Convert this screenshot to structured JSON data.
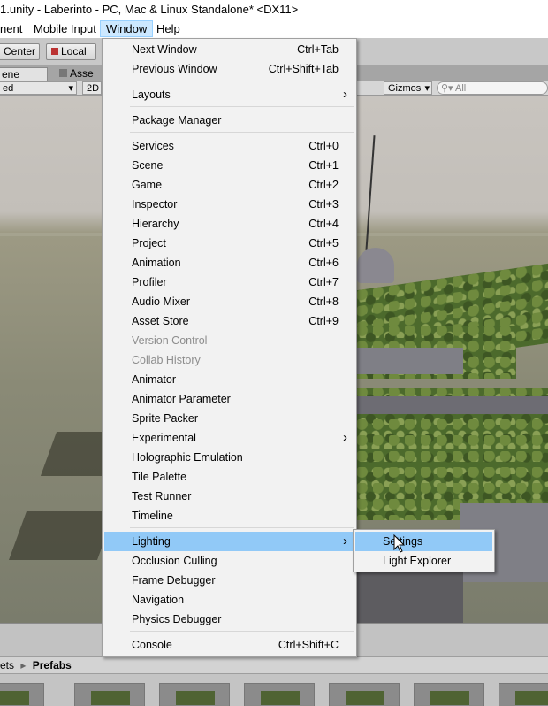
{
  "window": {
    "title": "1.unity - Laberinto - PC, Mac & Linux Standalone* <DX11>"
  },
  "menubar": {
    "items": [
      "nent",
      "Mobile Input",
      "Window",
      "Help"
    ],
    "active": "Window"
  },
  "toolbar": {
    "center_label": "Center",
    "local_label": "Local"
  },
  "tabs": {
    "scene": "ene",
    "assets": "Asse"
  },
  "scenebar": {
    "shaded": "ed",
    "mode_2d": "2D",
    "gizmos": "Gizmos",
    "search_placeholder": "All"
  },
  "window_menu": {
    "items": [
      {
        "label": "Next Window",
        "shortcut": "Ctrl+Tab"
      },
      {
        "label": "Previous Window",
        "shortcut": "Ctrl+Shift+Tab"
      },
      {
        "label": "Layouts",
        "submenu": true
      },
      {
        "label": "Package Manager"
      },
      {
        "label": "Services",
        "shortcut": "Ctrl+0"
      },
      {
        "label": "Scene",
        "shortcut": "Ctrl+1"
      },
      {
        "label": "Game",
        "shortcut": "Ctrl+2"
      },
      {
        "label": "Inspector",
        "shortcut": "Ctrl+3"
      },
      {
        "label": "Hierarchy",
        "shortcut": "Ctrl+4"
      },
      {
        "label": "Project",
        "shortcut": "Ctrl+5"
      },
      {
        "label": "Animation",
        "shortcut": "Ctrl+6"
      },
      {
        "label": "Profiler",
        "shortcut": "Ctrl+7"
      },
      {
        "label": "Audio Mixer",
        "shortcut": "Ctrl+8"
      },
      {
        "label": "Asset Store",
        "shortcut": "Ctrl+9"
      },
      {
        "label": "Version Control",
        "disabled": true
      },
      {
        "label": "Collab History",
        "disabled": true
      },
      {
        "label": "Animator"
      },
      {
        "label": "Animator Parameter"
      },
      {
        "label": "Sprite Packer"
      },
      {
        "label": "Experimental",
        "submenu": true
      },
      {
        "label": "Holographic Emulation"
      },
      {
        "label": "Tile Palette"
      },
      {
        "label": "Test Runner"
      },
      {
        "label": "Timeline"
      },
      {
        "label": "Lighting",
        "submenu": true,
        "highlighted": true
      },
      {
        "label": "Occlusion Culling"
      },
      {
        "label": "Frame Debugger"
      },
      {
        "label": "Navigation"
      },
      {
        "label": "Physics Debugger"
      },
      {
        "label": "Console",
        "shortcut": "Ctrl+Shift+C"
      }
    ]
  },
  "lighting_submenu": {
    "items": [
      {
        "label": "Settings",
        "highlighted": true
      },
      {
        "label": "Light Explorer"
      }
    ]
  },
  "project": {
    "breadcrumb_prefix": "ets",
    "breadcrumb_current": "Prefabs"
  }
}
